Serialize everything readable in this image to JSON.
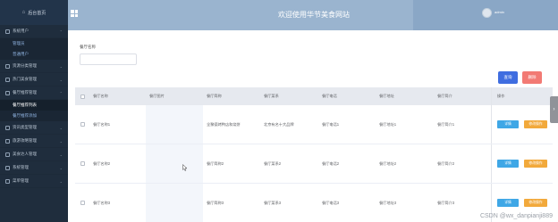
{
  "sidebar": {
    "brand": "后台首页",
    "items": [
      {
        "label": "系统用户",
        "type": "menu",
        "expanded": true
      },
      {
        "label": "管理员",
        "type": "sub"
      },
      {
        "label": "普通用户",
        "type": "sub"
      },
      {
        "label": "资源分类管理",
        "type": "menu"
      },
      {
        "label": "热门美食管理",
        "type": "menu"
      },
      {
        "label": "餐厅推荐管理",
        "type": "menu",
        "expanded": true
      },
      {
        "label": "餐厅推荐列表",
        "type": "sub",
        "active": true
      },
      {
        "label": "餐厅推荐添加",
        "type": "sub"
      },
      {
        "label": "资讯类型管理",
        "type": "menu"
      },
      {
        "label": "旅游攻略管理",
        "type": "menu"
      },
      {
        "label": "美食达人管理",
        "type": "menu"
      },
      {
        "label": "系统管理",
        "type": "menu"
      },
      {
        "label": "菜单管理",
        "type": "menu"
      }
    ]
  },
  "header": {
    "title": "欢迎使用华节美食网站",
    "username": "admin"
  },
  "filter": {
    "label": "餐厅名称",
    "value": ""
  },
  "buttons": {
    "search": "查询",
    "delete": "删除"
  },
  "table": {
    "headers": [
      "餐厅名称",
      "餐厅图片",
      "餐厅简称",
      "餐厅菜系",
      "餐厅电话",
      "餐厅地址",
      "餐厅简介",
      "操作"
    ],
    "rows": [
      {
        "name": "餐厅名称1",
        "image": "",
        "short": "全聚德烤鸭店和烧饼",
        "cuisine": "北京有名十大品牌",
        "phone": "餐厅电话1",
        "address": "餐厅地址1",
        "intro": "餐厅简介1"
      },
      {
        "name": "餐厅名称2",
        "image": "",
        "short": "餐厅简称2",
        "cuisine": "餐厅菜系2",
        "phone": "餐厅电话2",
        "address": "餐厅地址2",
        "intro": "餐厅简介2"
      },
      {
        "name": "餐厅名称3",
        "image": "",
        "short": "餐厅简称3",
        "cuisine": "餐厅菜系3",
        "phone": "餐厅电话3",
        "address": "餐厅地址3",
        "intro": "餐厅简介3"
      }
    ],
    "actions": {
      "detail": "详情",
      "edit": "修改操作"
    }
  },
  "side_handle": "›",
  "watermark": "CSDN @wx_danpianji889",
  "colors": {
    "sidebar_bg": "#1f2d3d",
    "header_bg": "#9ab4cf",
    "search_btn": "#3f6de0",
    "delete_btn": "#f27a74",
    "detail_btn": "#3fa7e6",
    "edit_btn": "#f2a93b"
  }
}
